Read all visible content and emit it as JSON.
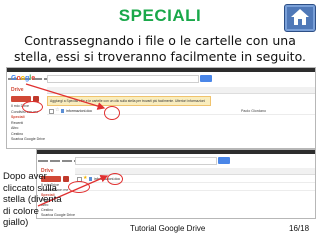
{
  "slide": {
    "title": "SPECIALI",
    "subtitle": "Contrassegnando i file o le cartelle con una stella, essi si troveranno facilmente in seguito.",
    "caption": "Dopo aver cliccato sulla stella (diventa di colore giallo)",
    "footer_left": "Tutorial Google Drive",
    "footer_right": "16/18"
  },
  "screenshot1": {
    "logo": "Google",
    "drive_label": "Drive",
    "sidebar": [
      "Il mio Drive",
      "Condivisi con me",
      "Speciali",
      "Recenti",
      "Altro",
      "Cestino",
      "Scarica Google Drive"
    ],
    "banner": "Aggiungi a Speciali i file e le cartelle con un clic sulla stella per trovarli più facilmente. Ulteriori informazioni",
    "file_name": "informazioni.doc",
    "owner": "Paolo Giordano"
  },
  "screenshot2": {
    "drive_label": "Drive",
    "sidebar": [
      "Il mio Drive",
      "Condivisi con me",
      "Speciali",
      "Recenti",
      "Altro",
      "Cestino",
      "Scarica Google Drive"
    ],
    "file_name": "informazioni.doc"
  },
  "colors": {
    "title": "#1aa84a",
    "home_button": "#4f78b8",
    "highlight_ring": "#e03030",
    "star_gold": "#f4b400",
    "drive_red": "#d14836"
  },
  "icons": {
    "home": "home-icon",
    "star_empty": "star-empty-icon",
    "star_filled": "star-filled-icon"
  }
}
